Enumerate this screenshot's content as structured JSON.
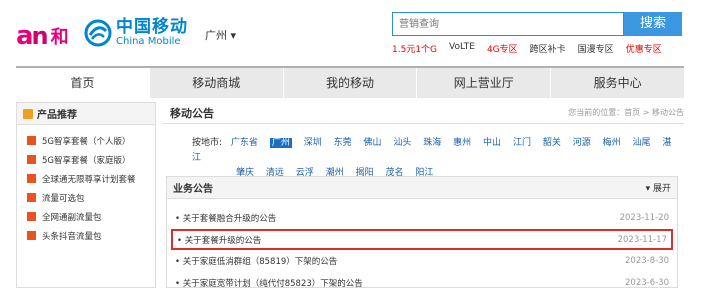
{
  "header": {
    "and_logo": {
      "a": "a",
      "n": "n",
      "he": "和"
    },
    "cm_logo": {
      "cn": "中国移动",
      "en": "China Mobile"
    },
    "city": "广州 ▾",
    "search_placeholder": "营销查询",
    "search_button": "搜索",
    "hot_links": [
      {
        "label": "1.5元1个G",
        "red": true
      },
      {
        "label": "VoLTE",
        "red": false
      },
      {
        "label": "4G专区",
        "red": true
      },
      {
        "label": "跨区补卡",
        "red": false
      },
      {
        "label": "国漫专区",
        "red": false
      },
      {
        "label": "优惠专区",
        "red": true
      }
    ]
  },
  "nav": [
    "首页",
    "移动商城",
    "我的移动",
    "网上营业厅",
    "服务中心"
  ],
  "sidebar": {
    "title": "产品推荐",
    "items": [
      "5G智享套餐（个人版）",
      "5G智享套餐（家庭版）",
      "全球通无限尊享计划套餐",
      "流量可选包",
      "全网通副流量包",
      "头条抖音流量包"
    ]
  },
  "main": {
    "title": "移动公告",
    "breadcrumb": "您当前的位置：首页 > 移动公告",
    "city_label": "按地市:",
    "cities_row1": [
      "广东省",
      "广州",
      "深圳",
      "东莞",
      "佛山",
      "汕头",
      "珠海",
      "惠州",
      "中山",
      "江门",
      "韶关",
      "河源",
      "梅州",
      "汕尾",
      "湛江"
    ],
    "cities_row2": [
      "肇庆",
      "清远",
      "云浮",
      "潮州",
      "揭阳",
      "茂名",
      "阳江"
    ],
    "selected_city": "广州",
    "notice": {
      "title": "业务公告",
      "expand": "▾ 展开",
      "items": [
        {
          "title": "• 关于套餐融合升级的公告",
          "date": "2023-11-20",
          "highlight": false
        },
        {
          "title": "• 关于套餐升级的公告",
          "date": "2023-11-17",
          "highlight": true
        },
        {
          "title": "• 关于家庭低消群组（85819）下架的公告",
          "date": "2023-8-30",
          "highlight": false
        },
        {
          "title": "• 关于家庭宽带计划（纯代付85823）下架的公告",
          "date": "2023-6-30",
          "highlight": false
        }
      ]
    }
  }
}
